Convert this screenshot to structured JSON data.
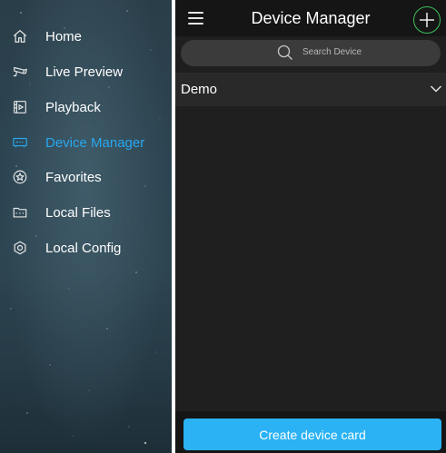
{
  "sidebar": {
    "items": [
      {
        "label": "Home",
        "icon": "home-icon"
      },
      {
        "label": "Live Preview",
        "icon": "camera-icon"
      },
      {
        "label": "Playback",
        "icon": "playback-icon"
      },
      {
        "label": "Device Manager",
        "icon": "device-icon",
        "active": true
      },
      {
        "label": "Favorites",
        "icon": "star-icon"
      },
      {
        "label": "Local Files",
        "icon": "folder-icon"
      },
      {
        "label": "Local Config",
        "icon": "settings-icon"
      }
    ],
    "active_color": "#28a8f0"
  },
  "header": {
    "title": "Device Manager",
    "menu_icon": "hamburger-icon",
    "add_icon": "plus-icon",
    "add_color": "#3cc05a"
  },
  "search": {
    "placeholder": "Search Device"
  },
  "group": {
    "name": "Demo",
    "expanded_icon": "chevron-down-icon"
  },
  "footer": {
    "create_label": "Create device card",
    "button_color": "#2ab2f4"
  }
}
